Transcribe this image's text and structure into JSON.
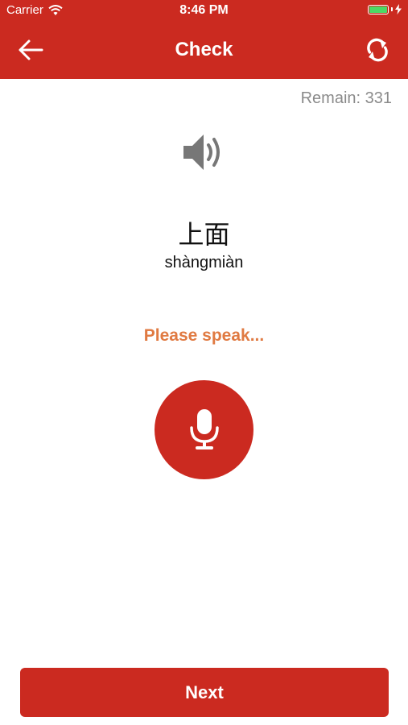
{
  "status_bar": {
    "carrier": "Carrier",
    "time": "8:46 PM",
    "battery_color": "#4cd964"
  },
  "nav": {
    "title": "Check",
    "back_icon": "arrow-left-icon",
    "refresh_icon": "refresh-icon"
  },
  "remain_label": "Remain: 331",
  "word": {
    "hanzi": "上面",
    "pinyin": "shàngmiàn",
    "audio_icon": "speaker-icon"
  },
  "prompt": "Please speak...",
  "mic_icon": "microphone-icon",
  "next_label": "Next",
  "colors": {
    "brand": "#cb2a20",
    "prompt": "#e07a42",
    "muted": "#8a8a8a"
  }
}
